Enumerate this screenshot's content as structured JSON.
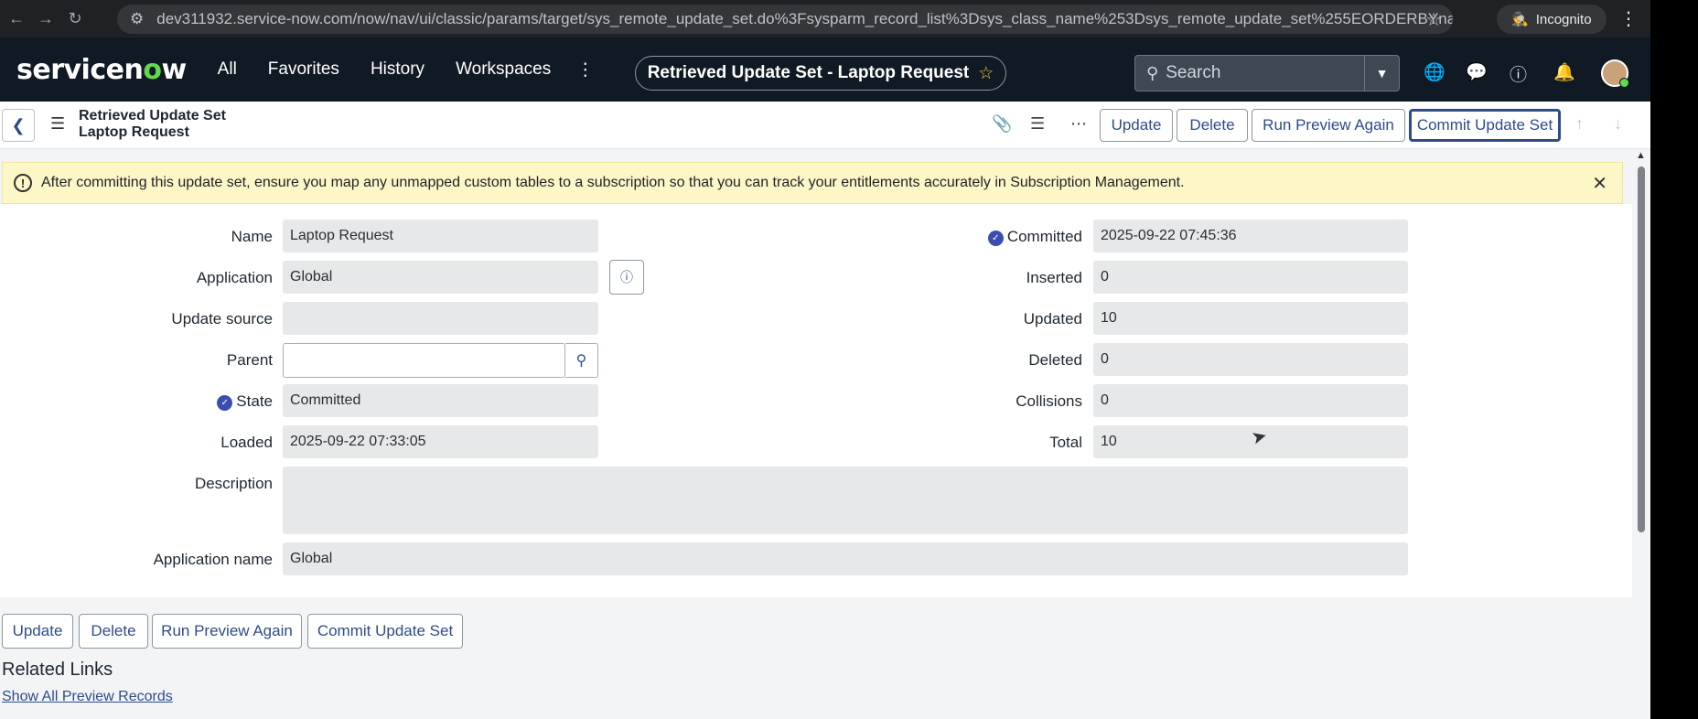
{
  "browser": {
    "url": "dev311932.service-now.com/now/nav/ui/classic/params/target/sys_remote_update_set.do%3Fsysparm_record_list%3Dsys_class_name%253Dsys_remote_update_set%255EORDERBYname%26...",
    "incognito_label": "Incognito"
  },
  "header": {
    "logo_text_a": "servicen",
    "logo_text_o": "o",
    "logo_text_b": "w",
    "nav": [
      "All",
      "Favorites",
      "History",
      "Workspaces"
    ],
    "context_title": "Retrieved Update Set - Laptop Request",
    "search_placeholder": "Search"
  },
  "form_header": {
    "title_line1": "Retrieved Update Set",
    "title_line2": "Laptop Request",
    "buttons": {
      "update": "Update",
      "delete": "Delete",
      "run_preview": "Run Preview Again",
      "commit": "Commit Update Set"
    }
  },
  "banner": {
    "text": "After committing this update set, ensure you map any unmapped custom tables to a subscription so that you can track your entitlements accurately in Subscription Management."
  },
  "form": {
    "left": {
      "name_label": "Name",
      "name_value": "Laptop Request",
      "application_label": "Application",
      "application_value": "Global",
      "update_source_label": "Update source",
      "update_source_value": "",
      "parent_label": "Parent",
      "parent_value": "",
      "state_label": "State",
      "state_value": "Committed",
      "loaded_label": "Loaded",
      "loaded_value": "2025-09-22 07:33:05"
    },
    "right": {
      "committed_label": "Committed",
      "committed_value": "2025-09-22 07:45:36",
      "inserted_label": "Inserted",
      "inserted_value": "0",
      "updated_label": "Updated",
      "updated_value": "10",
      "deleted_label": "Deleted",
      "deleted_value": "0",
      "collisions_label": "Collisions",
      "collisions_value": "0",
      "total_label": "Total",
      "total_value": "10"
    },
    "description_label": "Description",
    "description_value": "",
    "application_name_label": "Application name",
    "application_name_value": "Global"
  },
  "bottom_buttons": {
    "update": "Update",
    "delete": "Delete",
    "run_preview": "Run Preview Again",
    "commit": "Commit Update Set"
  },
  "related_links": {
    "title": "Related Links",
    "link": "Show All Preview Records"
  },
  "colors": {
    "header_bg": "#0f1a24",
    "accent": "#2e4c8a",
    "banner_bg": "#fdf6c6",
    "logo_green": "#62d84e"
  }
}
